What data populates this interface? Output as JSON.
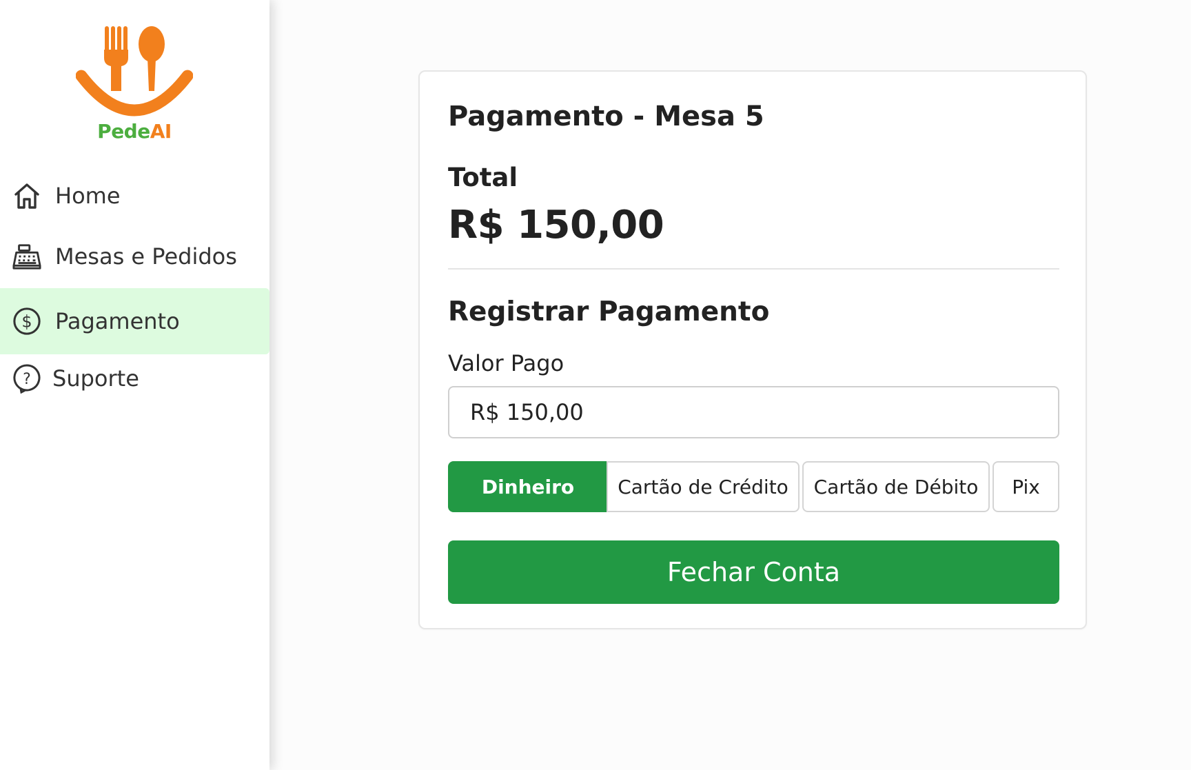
{
  "app": {
    "logo_text_pede": "Pede",
    "logo_text_ai": "AI",
    "brand_colors": {
      "orange": "#f2801d",
      "green": "#4cae3f"
    }
  },
  "sidebar": {
    "items": [
      {
        "label": "Home",
        "icon": "home-icon",
        "active": false
      },
      {
        "label": "Mesas e Pedidos",
        "icon": "cash-register-icon",
        "active": false
      },
      {
        "label": "Pagamento",
        "icon": "dollar-circle-icon",
        "active": true
      },
      {
        "label": "Suporte",
        "icon": "help-circle-icon",
        "active": false
      }
    ],
    "active_bg": "#ddfbdf"
  },
  "payment": {
    "title": "Pagamento - Mesa 5",
    "total_label": "Total",
    "total_value": "R$ 150,00",
    "section_title": "Registrar Pagamento",
    "amount_label": "Valor Pago",
    "amount_value": "R$ 150,00",
    "methods": [
      {
        "label": "Dinheiro",
        "selected": true
      },
      {
        "label": "Cartão de Crédito",
        "selected": false
      },
      {
        "label": "Cartão de Débito",
        "selected": false
      },
      {
        "label": "Pix",
        "selected": false
      }
    ],
    "submit_label": "Fechar Conta",
    "accent_color": "#229944"
  }
}
